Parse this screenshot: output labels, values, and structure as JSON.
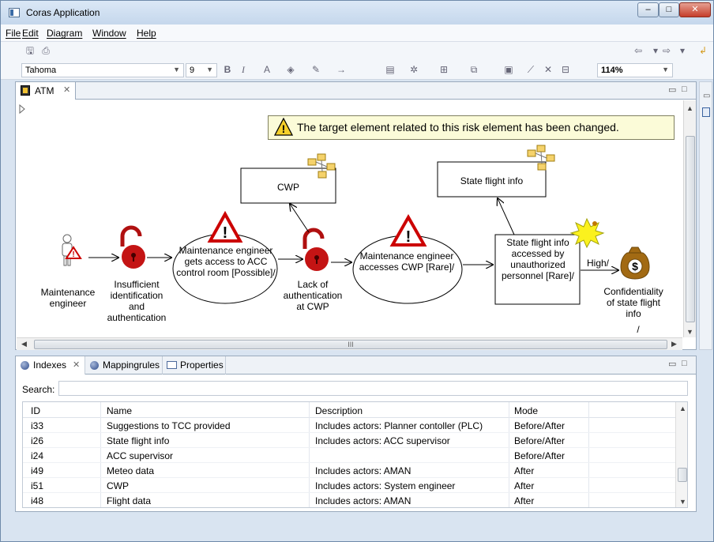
{
  "window": {
    "title": "Coras Application"
  },
  "menu": [
    {
      "label": "File"
    },
    {
      "label": "Edit"
    },
    {
      "label": "Diagram"
    },
    {
      "label": "Window"
    },
    {
      "label": "Help"
    }
  ],
  "toolbar": {
    "font": "Tahoma",
    "size": "9",
    "zoom": "114%"
  },
  "editor": {
    "tab_label": "ATM",
    "warning": "The target element related to this risk element has been changed."
  },
  "diagram": {
    "actor": "Maintenance engineer",
    "vuln1": "Insufficient identification and authentication",
    "scenario1": "Maintenance engineer gets access to ACC control room [Possible]/",
    "vuln2": "Lack of authentication at CWP",
    "scenario2": "Maintenance engineer accesses CWP [Rare]/",
    "asset_cwp": "CWP",
    "asset_sfi": "State flight info",
    "incident": "State flight info accessed by unauthorized personnel [Rare]/",
    "consequence": "High/",
    "confidentiality": "Confidentiality of state flight info",
    "slash": "/"
  },
  "bottom_tabs": [
    {
      "label": "Indexes"
    },
    {
      "label": "Mappingrules"
    },
    {
      "label": "Properties"
    }
  ],
  "search": {
    "label": "Search:",
    "value": ""
  },
  "table": {
    "columns": [
      "ID",
      "Name",
      "Description",
      "Mode"
    ],
    "rows": [
      [
        "i33",
        "Suggestions to TCC provided",
        "Includes actors: Planner contoller (PLC)",
        "Before/After"
      ],
      [
        "i26",
        "State flight info",
        "Includes actors: ACC supervisor",
        "Before/After"
      ],
      [
        "i24",
        "ACC supervisor",
        "",
        "Before/After"
      ],
      [
        "i49",
        "Meteo data",
        "Includes actors: AMAN",
        "After"
      ],
      [
        "i51",
        "CWP",
        "Includes actors: System engineer",
        "After"
      ],
      [
        "i48",
        "Flight data",
        "Includes actors: AMAN",
        "After"
      ]
    ]
  }
}
